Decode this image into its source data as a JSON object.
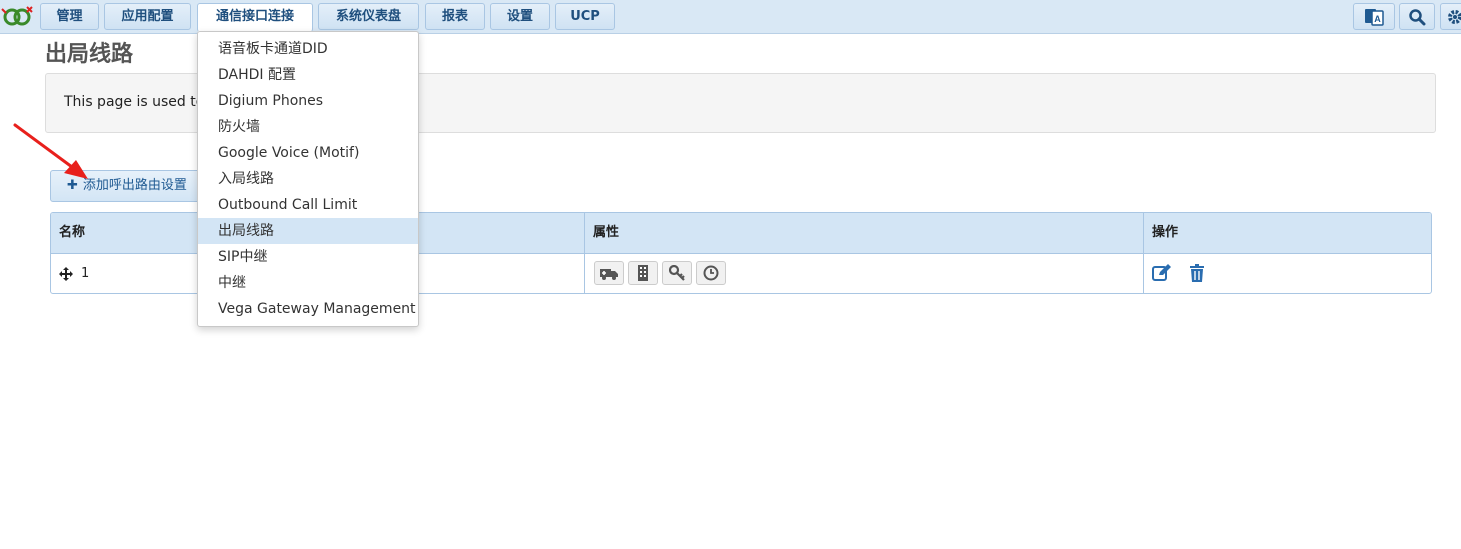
{
  "nav": {
    "items": [
      {
        "label": "管理"
      },
      {
        "label": "应用配置"
      },
      {
        "label": "通信接口连接"
      },
      {
        "label": "系统仪表盘"
      },
      {
        "label": "报表"
      },
      {
        "label": "设置"
      },
      {
        "label": "UCP"
      }
    ],
    "active_index": 2,
    "right_icons": [
      "language-icon",
      "search-icon",
      "gear-icon"
    ]
  },
  "page": {
    "title": "出局线路",
    "info_text": "This page is used to"
  },
  "add_button": {
    "icon": "plus-icon",
    "label": "添加呼出路由设置"
  },
  "table": {
    "columns": [
      "名称",
      "属性",
      "操作"
    ],
    "rows": [
      {
        "drag_icon": "move-icon",
        "name": "1",
        "attribute_icons": [
          "emergency-vehicle-icon",
          "building-icon",
          "key-icon",
          "clock-icon"
        ],
        "action_icons": [
          "edit-icon",
          "trash-icon"
        ]
      }
    ]
  },
  "dropdown": {
    "items": [
      {
        "label": "语音板卡通道DID"
      },
      {
        "label": "DAHDI 配置"
      },
      {
        "label": "Digium Phones"
      },
      {
        "label": "防火墙"
      },
      {
        "label": "Google Voice (Motif)"
      },
      {
        "label": "入局线路"
      },
      {
        "label": "Outbound Call Limit"
      },
      {
        "label": "出局线路"
      },
      {
        "label": "SIP中继"
      },
      {
        "label": "中继"
      },
      {
        "label": "Vega Gateway Management"
      }
    ],
    "selected_index": 7
  },
  "colors": {
    "nav_bg": "#d9e8f5",
    "accent": "#1f5a92",
    "highlight": "#d3e5f5",
    "annotation_arrow": "#e8201c"
  }
}
